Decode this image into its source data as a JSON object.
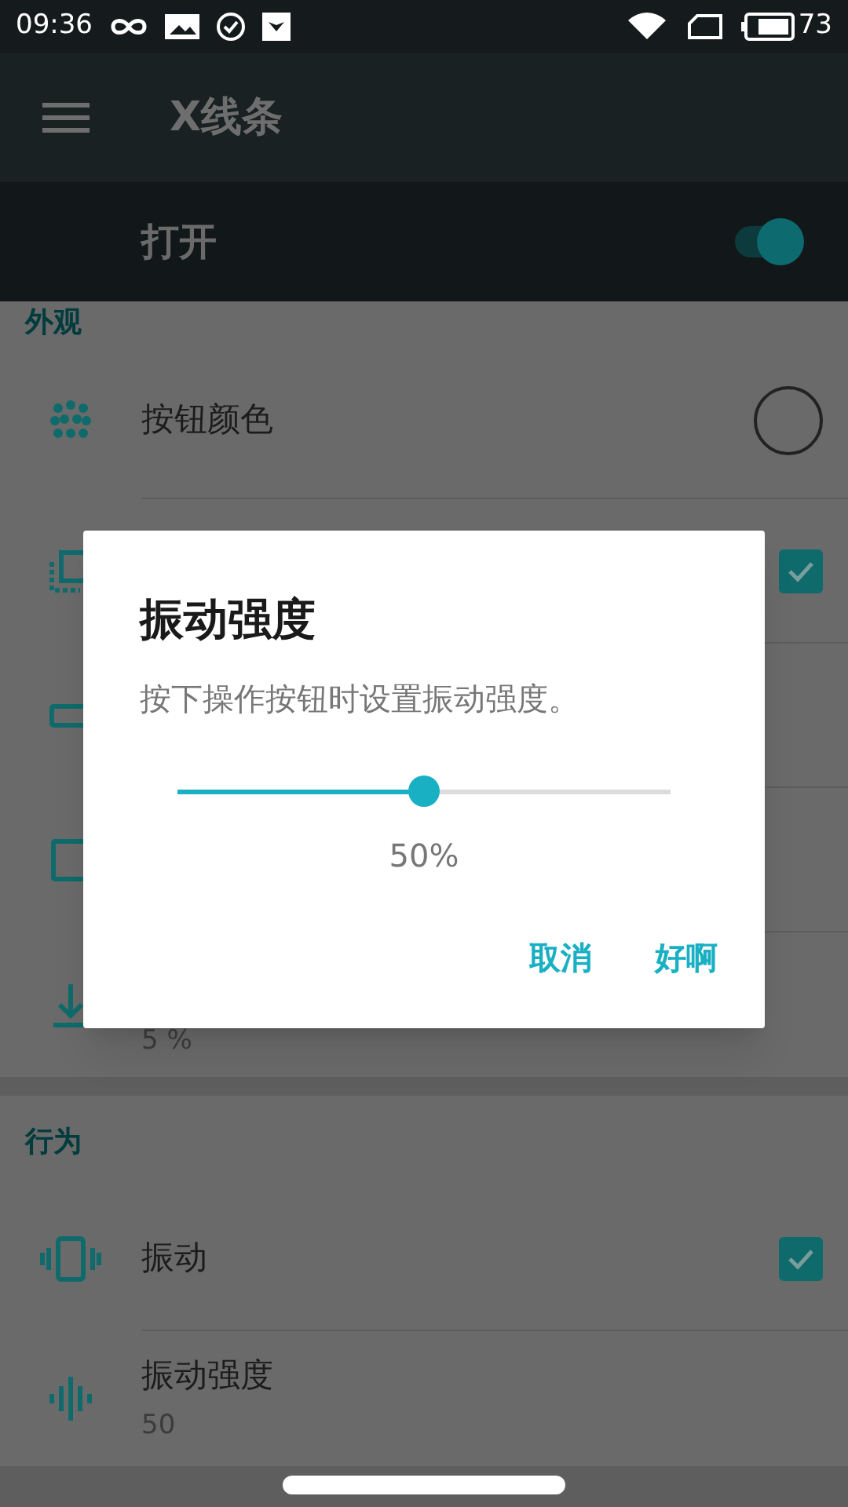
{
  "status_bar": {
    "time": "09:36",
    "battery": "73"
  },
  "toolbar": {
    "title": "X线条"
  },
  "master_switch": {
    "label": "打开",
    "on": true
  },
  "sections": [
    {
      "header": "外观",
      "items": [
        {
          "kind": "color",
          "title": "按钮颜色"
        },
        {
          "kind": "checkbox",
          "checked": true
        },
        {
          "kind": "plain"
        },
        {
          "kind": "plain"
        },
        {
          "kind": "value",
          "subtitle": "5 %"
        }
      ]
    },
    {
      "header": "行为",
      "items": [
        {
          "kind": "checkbox",
          "title": "振动",
          "checked": true
        },
        {
          "kind": "value",
          "title": "振动强度",
          "subtitle": "50"
        }
      ]
    }
  ],
  "dialog": {
    "title": "振动强度",
    "message": "按下操作按钮时设置振动强度。",
    "slider": {
      "level": 0.5
    },
    "reading": "50%",
    "buttons": [
      "取消",
      "好啊"
    ]
  }
}
